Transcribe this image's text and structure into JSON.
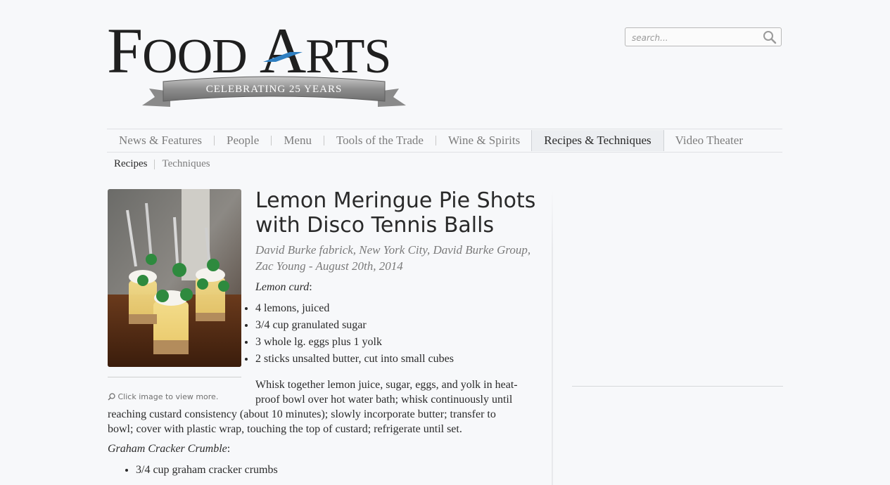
{
  "header": {
    "logo_text": "FOOD ARTS",
    "logo_tagline": "CELEBRATING 25 YEARS",
    "search_placeholder": "search..."
  },
  "nav": {
    "items": [
      {
        "label": "News & Features"
      },
      {
        "label": "People"
      },
      {
        "label": "Menu"
      },
      {
        "label": "Tools of the Trade"
      },
      {
        "label": "Wine & Spirits"
      },
      {
        "label": "Recipes & Techniques",
        "active": true
      },
      {
        "label": "Video Theater"
      }
    ]
  },
  "subnav": {
    "items": [
      {
        "label": "Recipes",
        "active": true
      },
      {
        "label": "Techniques"
      }
    ]
  },
  "article": {
    "title": "Lemon Meringue Pie Shots with Disco Tennis Balls",
    "byline": "David Burke fabrick, New York City, David Burke Group, Zac Young - August 20th, 2014",
    "image_caption": "Click image to view more.",
    "sections": [
      {
        "label": "Lemon curd",
        "ingredients": [
          "4 lemons, juiced",
          "3/4 cup granulated sugar",
          "3 whole lg. eggs plus 1 yolk",
          "2 sticks unsalted butter, cut into small cubes"
        ],
        "method": "Whisk together lemon juice, sugar, eggs, and yolk in heat-proof bowl over hot water bath; whisk continuously until reaching custard consistency (about 10 minutes); slowly incorporate butter; transfer to bowl; cover with plastic wrap, touching the top of custard; refrigerate until set."
      },
      {
        "label": "Graham Cracker Crumble",
        "ingredients": [
          "3/4 cup graham cracker crumbs"
        ]
      }
    ]
  },
  "colors": {
    "background": "#f7f8fa",
    "logo_accent": "#2f7fc1",
    "text": "#2a2a2a",
    "muted": "#7d7d7d"
  }
}
